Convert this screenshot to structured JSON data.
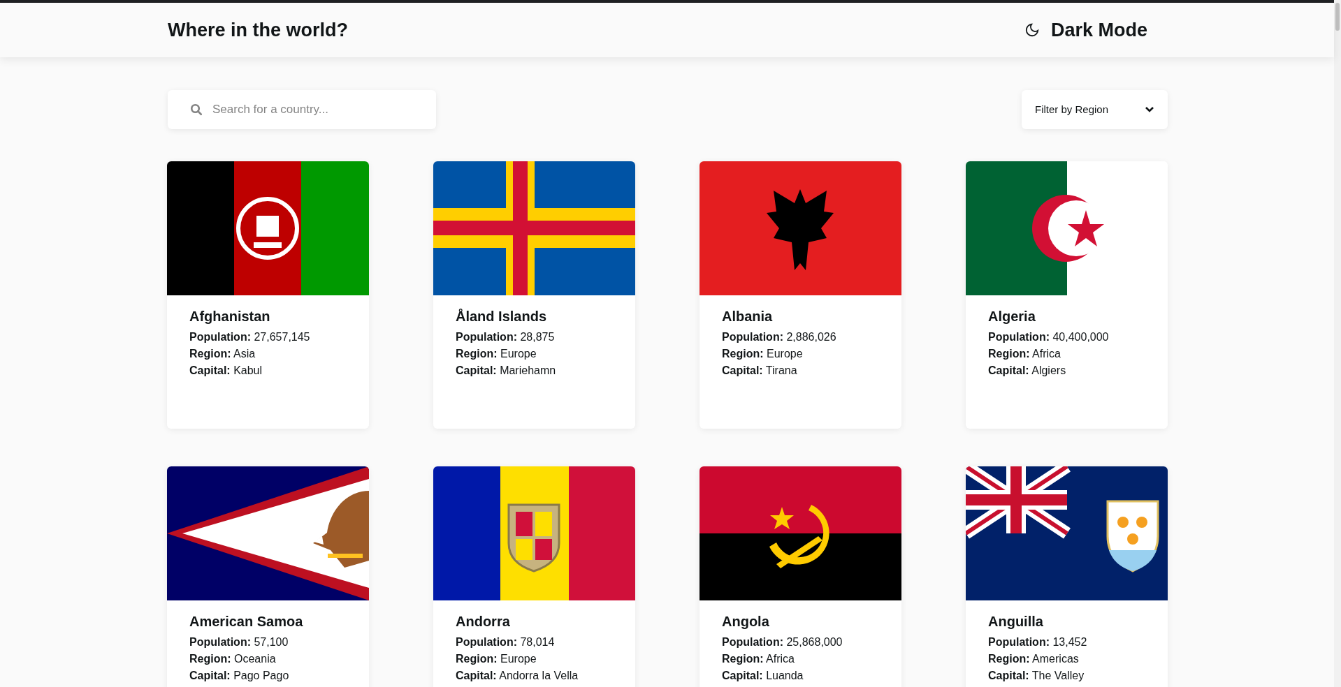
{
  "header": {
    "title": "Where in the world?",
    "theme_toggle": "Dark Mode"
  },
  "search": {
    "placeholder": "Search for a country..."
  },
  "filter": {
    "label": "Filter by Region"
  },
  "countries": [
    {
      "name": "Afghanistan",
      "population_label": "Population:",
      "population": "27,657,145",
      "region_label": "Region:",
      "region": "Asia",
      "capital_label": "Capital:",
      "capital": "Kabul"
    },
    {
      "name": "Åland Islands",
      "population_label": "Population:",
      "population": "28,875",
      "region_label": "Region:",
      "region": "Europe",
      "capital_label": "Capital:",
      "capital": "Mariehamn"
    },
    {
      "name": "Albania",
      "population_label": "Population:",
      "population": "2,886,026",
      "region_label": "Region:",
      "region": "Europe",
      "capital_label": "Capital:",
      "capital": "Tirana"
    },
    {
      "name": "Algeria",
      "population_label": "Population:",
      "population": "40,400,000",
      "region_label": "Region:",
      "region": "Africa",
      "capital_label": "Capital:",
      "capital": "Algiers"
    },
    {
      "name": "American Samoa",
      "population_label": "Population:",
      "population": "57,100",
      "region_label": "Region:",
      "region": "Oceania",
      "capital_label": "Capital:",
      "capital": "Pago Pago"
    },
    {
      "name": "Andorra",
      "population_label": "Population:",
      "population": "78,014",
      "region_label": "Region:",
      "region": "Europe",
      "capital_label": "Capital:",
      "capital": "Andorra la Vella"
    },
    {
      "name": "Angola",
      "population_label": "Population:",
      "population": "25,868,000",
      "region_label": "Region:",
      "region": "Africa",
      "capital_label": "Capital:",
      "capital": "Luanda"
    },
    {
      "name": "Anguilla",
      "population_label": "Population:",
      "population": "13,452",
      "region_label": "Region:",
      "region": "Americas",
      "capital_label": "Capital:",
      "capital": "The Valley"
    }
  ]
}
